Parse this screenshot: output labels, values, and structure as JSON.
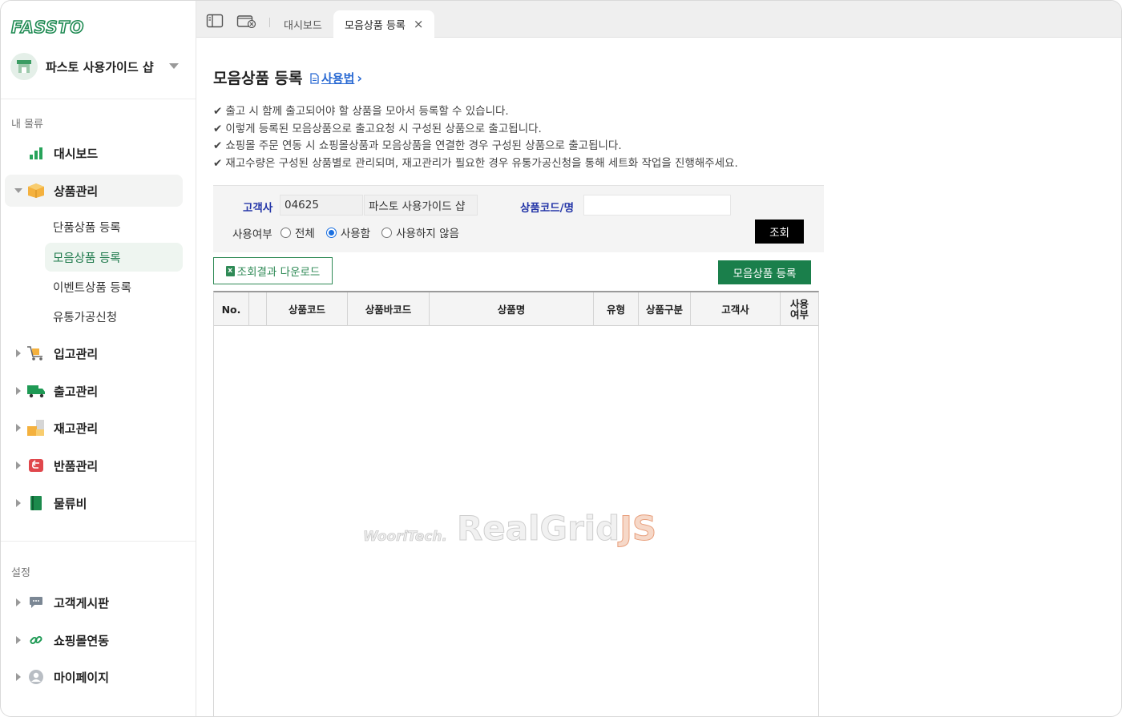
{
  "brand": {
    "logo_text": "FASSTO",
    "accent": "#1e8a52"
  },
  "shop": {
    "name": "파스토 사용가이드 샵"
  },
  "sidebar": {
    "section_logistics": "내 물류",
    "dashboard": "대시보드",
    "product": {
      "label": "상품관리",
      "subitems": [
        "단품상품 등록",
        "모음상품 등록",
        "이벤트상품 등록",
        "유통가공신청"
      ]
    },
    "inbound": "입고관리",
    "outbound": "출고관리",
    "inventory": "재고관리",
    "returns": "반품관리",
    "logistics_fee": "물류비",
    "section_settings": "설정",
    "board": "고객게시판",
    "mall_link": "쇼핑몰연동",
    "mypage": "마이페이지"
  },
  "tabs": {
    "dashboard": "대시보드",
    "active": "모음상품 등록",
    "close_glyph": "×"
  },
  "page": {
    "title": "모음상품 등록",
    "howto": "사용법",
    "howto_chevron": "›",
    "check_glyph": "✔",
    "notes": [
      "출고 시 함께 출고되어야 할 상품을 모아서 등록할 수 있습니다.",
      "이렇게 등록된 모음상품으로 출고요청 시 구성된 상품으로 출고됩니다.",
      "쇼핑몰 주문 연동 시 쇼핑몰상품과 모음상품을 연결한 경우 구성된 상품으로 출고됩니다.",
      "재고수량은 구성된 상품별로 관리되며, 재고관리가 필요한 경우 유통가공신청을 통해 세트화 작업을 진행해주세요."
    ]
  },
  "filter": {
    "customer_label": "고객사",
    "customer_code": "04625",
    "customer_name": "파스토 사용가이드 샵",
    "product_code_label": "상품코드/명",
    "product_code_value": "",
    "use_label": "사용여부",
    "options": [
      "전체",
      "사용함",
      "사용하지 않음"
    ],
    "selected": "사용함",
    "search_button": "조회"
  },
  "actions": {
    "download": "조회결과 다운로드",
    "register": "모음상품 등록"
  },
  "grid": {
    "columns": [
      "No.",
      "",
      "상품코드",
      "상품바코드",
      "상품명",
      "유형",
      "상품구분",
      "고객사",
      "사용\n여부"
    ],
    "rows": [],
    "watermark_left": "WooriTech.",
    "watermark_main": "RealGrid",
    "watermark_js": "JS"
  }
}
